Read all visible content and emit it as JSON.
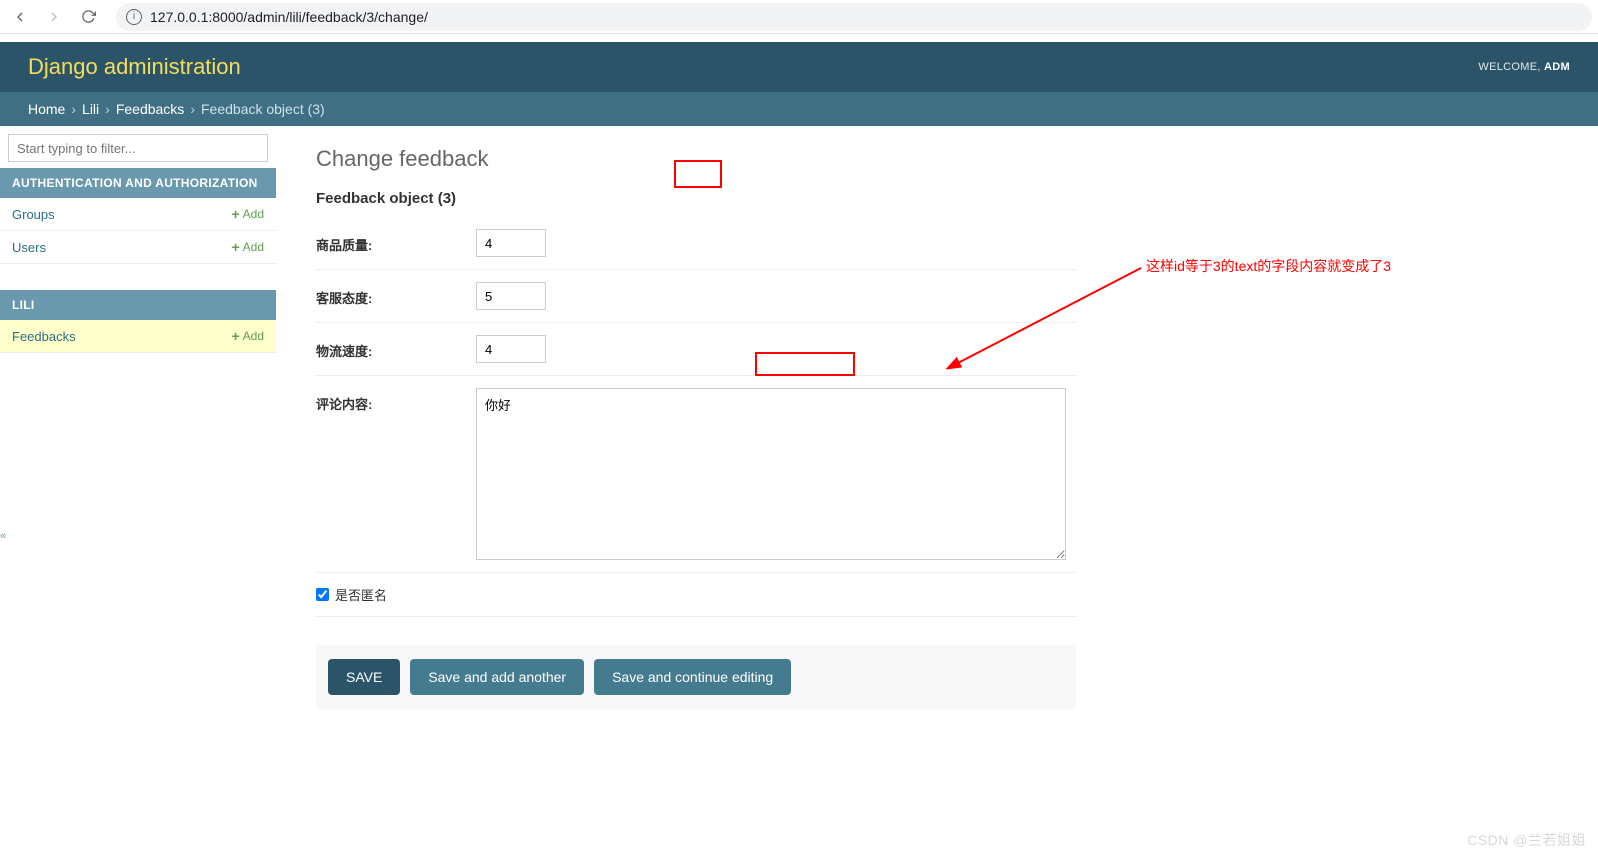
{
  "browser": {
    "url": "127.0.0.1:8000/admin/lili/feedback/3/change/"
  },
  "header": {
    "brand": "Django administration",
    "welcome": "WELCOME, ",
    "user": "ADM"
  },
  "breadcrumbs": {
    "home": "Home",
    "app": "Lili",
    "model": "Feedbacks",
    "current": "Feedback object (3)",
    "sep": "›"
  },
  "sidebar": {
    "filter_placeholder": "Start typing to filter...",
    "apps": [
      {
        "caption": "AUTHENTICATION AND AUTHORIZATION",
        "models": [
          {
            "name": "Groups",
            "add": "Add",
            "selected": false
          },
          {
            "name": "Users",
            "add": "Add",
            "selected": false
          }
        ]
      },
      {
        "caption": "LILI",
        "models": [
          {
            "name": "Feedbacks",
            "add": "Add",
            "selected": true
          }
        ]
      }
    ]
  },
  "content": {
    "title": "Change feedback",
    "object_name": "Feedback object (3)",
    "fields": {
      "quality": {
        "label": "商品质量:",
        "value": "4"
      },
      "service": {
        "label": "客服态度:",
        "value": "5"
      },
      "delivery": {
        "label": "物流速度:",
        "value": "4"
      },
      "text": {
        "label": "评论内容:",
        "value": "你好"
      },
      "anon": {
        "label": "是否匿名",
        "checked": true
      }
    },
    "buttons": {
      "save": "SAVE",
      "save_add": "Save and add another",
      "save_cont": "Save and continue editing"
    }
  },
  "annotation": {
    "text": "这样id等于3的text的字段内容就变成了3"
  },
  "watermark": "CSDN @兰若姐姐"
}
